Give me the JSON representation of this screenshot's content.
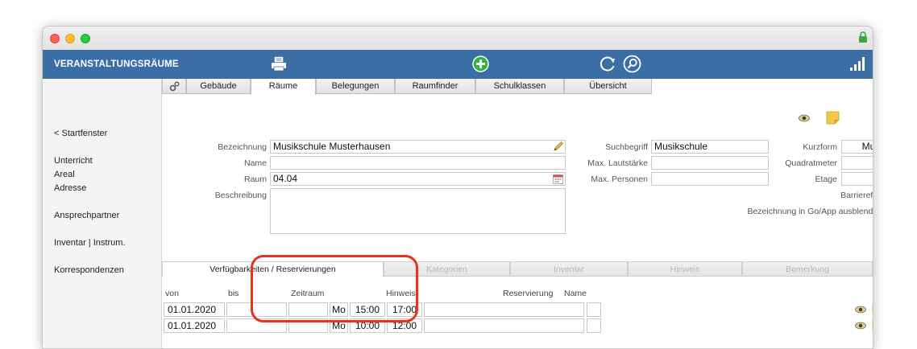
{
  "app": {
    "title": "VERANSTALTUNGSRÄUME"
  },
  "sidebar": {
    "back_label": "< Startfenster",
    "items": [
      "Unterricht",
      "Areal",
      "Adresse",
      "Ansprechpartner",
      "Inventar | Instrum.",
      "Korrespondenzen"
    ]
  },
  "tabs": [
    "Gebäude",
    "Räume",
    "Belegungen",
    "Raumfinder",
    "Schulklassen",
    "Übersicht"
  ],
  "active_tab": "Räume",
  "form": {
    "bezeichnung_label": "Bezeichnung",
    "bezeichnung_value": "Musikschule Musterhausen",
    "name_label": "Name",
    "name_value": "",
    "raum_label": "Raum",
    "raum_value": "04.04",
    "beschreibung_label": "Beschreibung",
    "beschreibung_value": "",
    "suchbegriff_label": "Suchbegriff",
    "suchbegriff_value": "Musikschule",
    "max_lautstaerke_label": "Max. Lautstärke",
    "max_lautstaerke_value": "",
    "max_personen_label": "Max. Personen",
    "max_personen_value": "",
    "kurzform_label": "Kurzform",
    "kurzform_value": "Mus",
    "quadratmeter_label": "Quadratmeter",
    "quadratmeter_value": "",
    "etage_label": "Etage",
    "etage_value": "",
    "barrierefrei_label": "Barrierefrei",
    "ausblenden_label": "Bezeichnung in Go/App ausblenden"
  },
  "bottom_tabs": [
    "Verfügbarkeiten / Reservierungen",
    "Kategorien",
    "Inventar",
    "Hinweis",
    "Bemerkung"
  ],
  "active_bottom_tab": "Verfügbarkeiten / Reservierungen",
  "table": {
    "headers": {
      "von": "von",
      "bis": "bis",
      "zeitraum": "Zeitraum",
      "hinweis": "Hinweis",
      "reservierung": "Reservierung",
      "name": "Name"
    },
    "rows": [
      {
        "von": "01.01.2020",
        "bis": "",
        "blank": "",
        "tag": "Mo",
        "start": "15:00",
        "ende": "17:00",
        "hinweis": "",
        "reservierung": "",
        "name": ""
      },
      {
        "von": "01.01.2020",
        "bis": "",
        "blank": "",
        "tag": "Mo",
        "start": "10:00",
        "ende": "12:00",
        "hinweis": "",
        "reservierung": "",
        "name": ""
      }
    ]
  },
  "icons": {
    "print": "printer-icon",
    "add": "add-circle-icon",
    "refresh": "refresh-icon",
    "search": "search-icon",
    "signal": "signal-bars-icon",
    "settings": "gear-icon",
    "view": "eye-icon",
    "note": "note-icon",
    "edit": "pencil-icon",
    "calendar": "calendar-icon",
    "delete": "delete-icon"
  },
  "colors": {
    "appbar": "#3a6ea5",
    "add_green": "#2db83d",
    "delete_red": "#e0231b",
    "highlight": "#e8321c"
  }
}
